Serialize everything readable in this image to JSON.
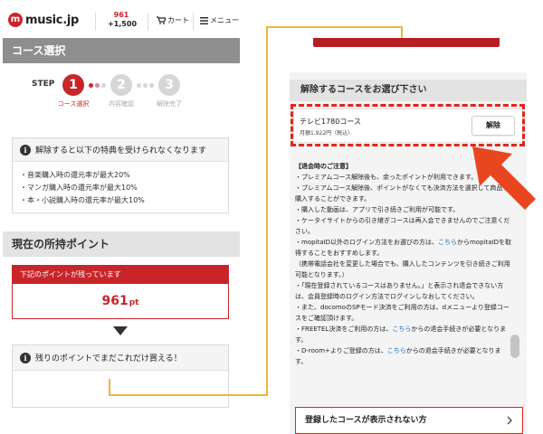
{
  "header": {
    "logo_text": "music.jp",
    "logo_mark": "m",
    "points_top": "961",
    "points_bottom": "+1,500",
    "cart_label": "カート",
    "menu_label": "メニュー"
  },
  "left": {
    "section_title": "コース選択",
    "step_label": "STEP",
    "steps": [
      {
        "num": "1",
        "caption": "コース選択"
      },
      {
        "num": "2",
        "caption": "内容確認"
      },
      {
        "num": "3",
        "caption": "解除完了"
      }
    ],
    "warning_title": "解除すると以下の特典を受けられなくなります",
    "benefits": [
      "・音楽購入時の還元率が最大20%",
      "・マンガ購入時の還元率が最大10%",
      "・本・小説購入時の還元率が最大10%"
    ],
    "points_section_title": "現在の所持ポイント",
    "remaining_label": "下記のポイントが残っています",
    "remaining_value": "961",
    "remaining_unit": "pt",
    "usage_title": "残りのポイントでまだこれだけ買える！"
  },
  "right": {
    "panel_title": "解除するコースをお選び下さい",
    "course_name": "テレビ1780コース",
    "course_price": "月額1,922円（税込）",
    "cancel_button": "解除",
    "notes_title": "【退会時のご注意】",
    "notes": [
      "・プレミアムコース解除後も、余ったポイントが利用できます。",
      "・プレミアムコース解除後、ポイントがなくても決済方法を選択して商品を購入することができます。",
      "・購入した動画は、アプリで引き続きご利用が可能です。",
      "・ケータイサイトからの引き継ぎコースは再入会できませんのでご注意ください。"
    ],
    "note_mopita_a": "・mopitaID以外のログイン方法をお選びの方は、",
    "note_mopita_link": "こちら",
    "note_mopita_b": "からmopitaIDを取得することをおすすめします。",
    "note_mopita_c": "（携帯電話会社を変更した場合でも、購入したコンテンツを引き続きご利用可能となります。）",
    "note_nocourse": "・「現在登録されているコースはありません。」と表示され退会できない方は、会員登録時のログイン方法でログインしなおしてください。",
    "note_docomo": "・また、docomoのSPモード決済をご利用の方は、dメニューより登録コースをご確認頂けます。",
    "note_freetel_a": "・FREETEL決済をご利用の方は、",
    "note_freetel_link": "こちら",
    "note_freetel_b": "からの退会手続きが必要となります。",
    "note_droom_a": "・D-room+よりご登録の方は、",
    "note_droom_link": "こちら",
    "note_droom_b": "からの退会手続きが必要となります。",
    "bottom_link": "登録したコースが表示されない方"
  },
  "colors": {
    "brand_red": "#c8252a",
    "highlight_red": "#e3261b",
    "connector": "#f0b43a",
    "link_blue": "#2070c0"
  }
}
